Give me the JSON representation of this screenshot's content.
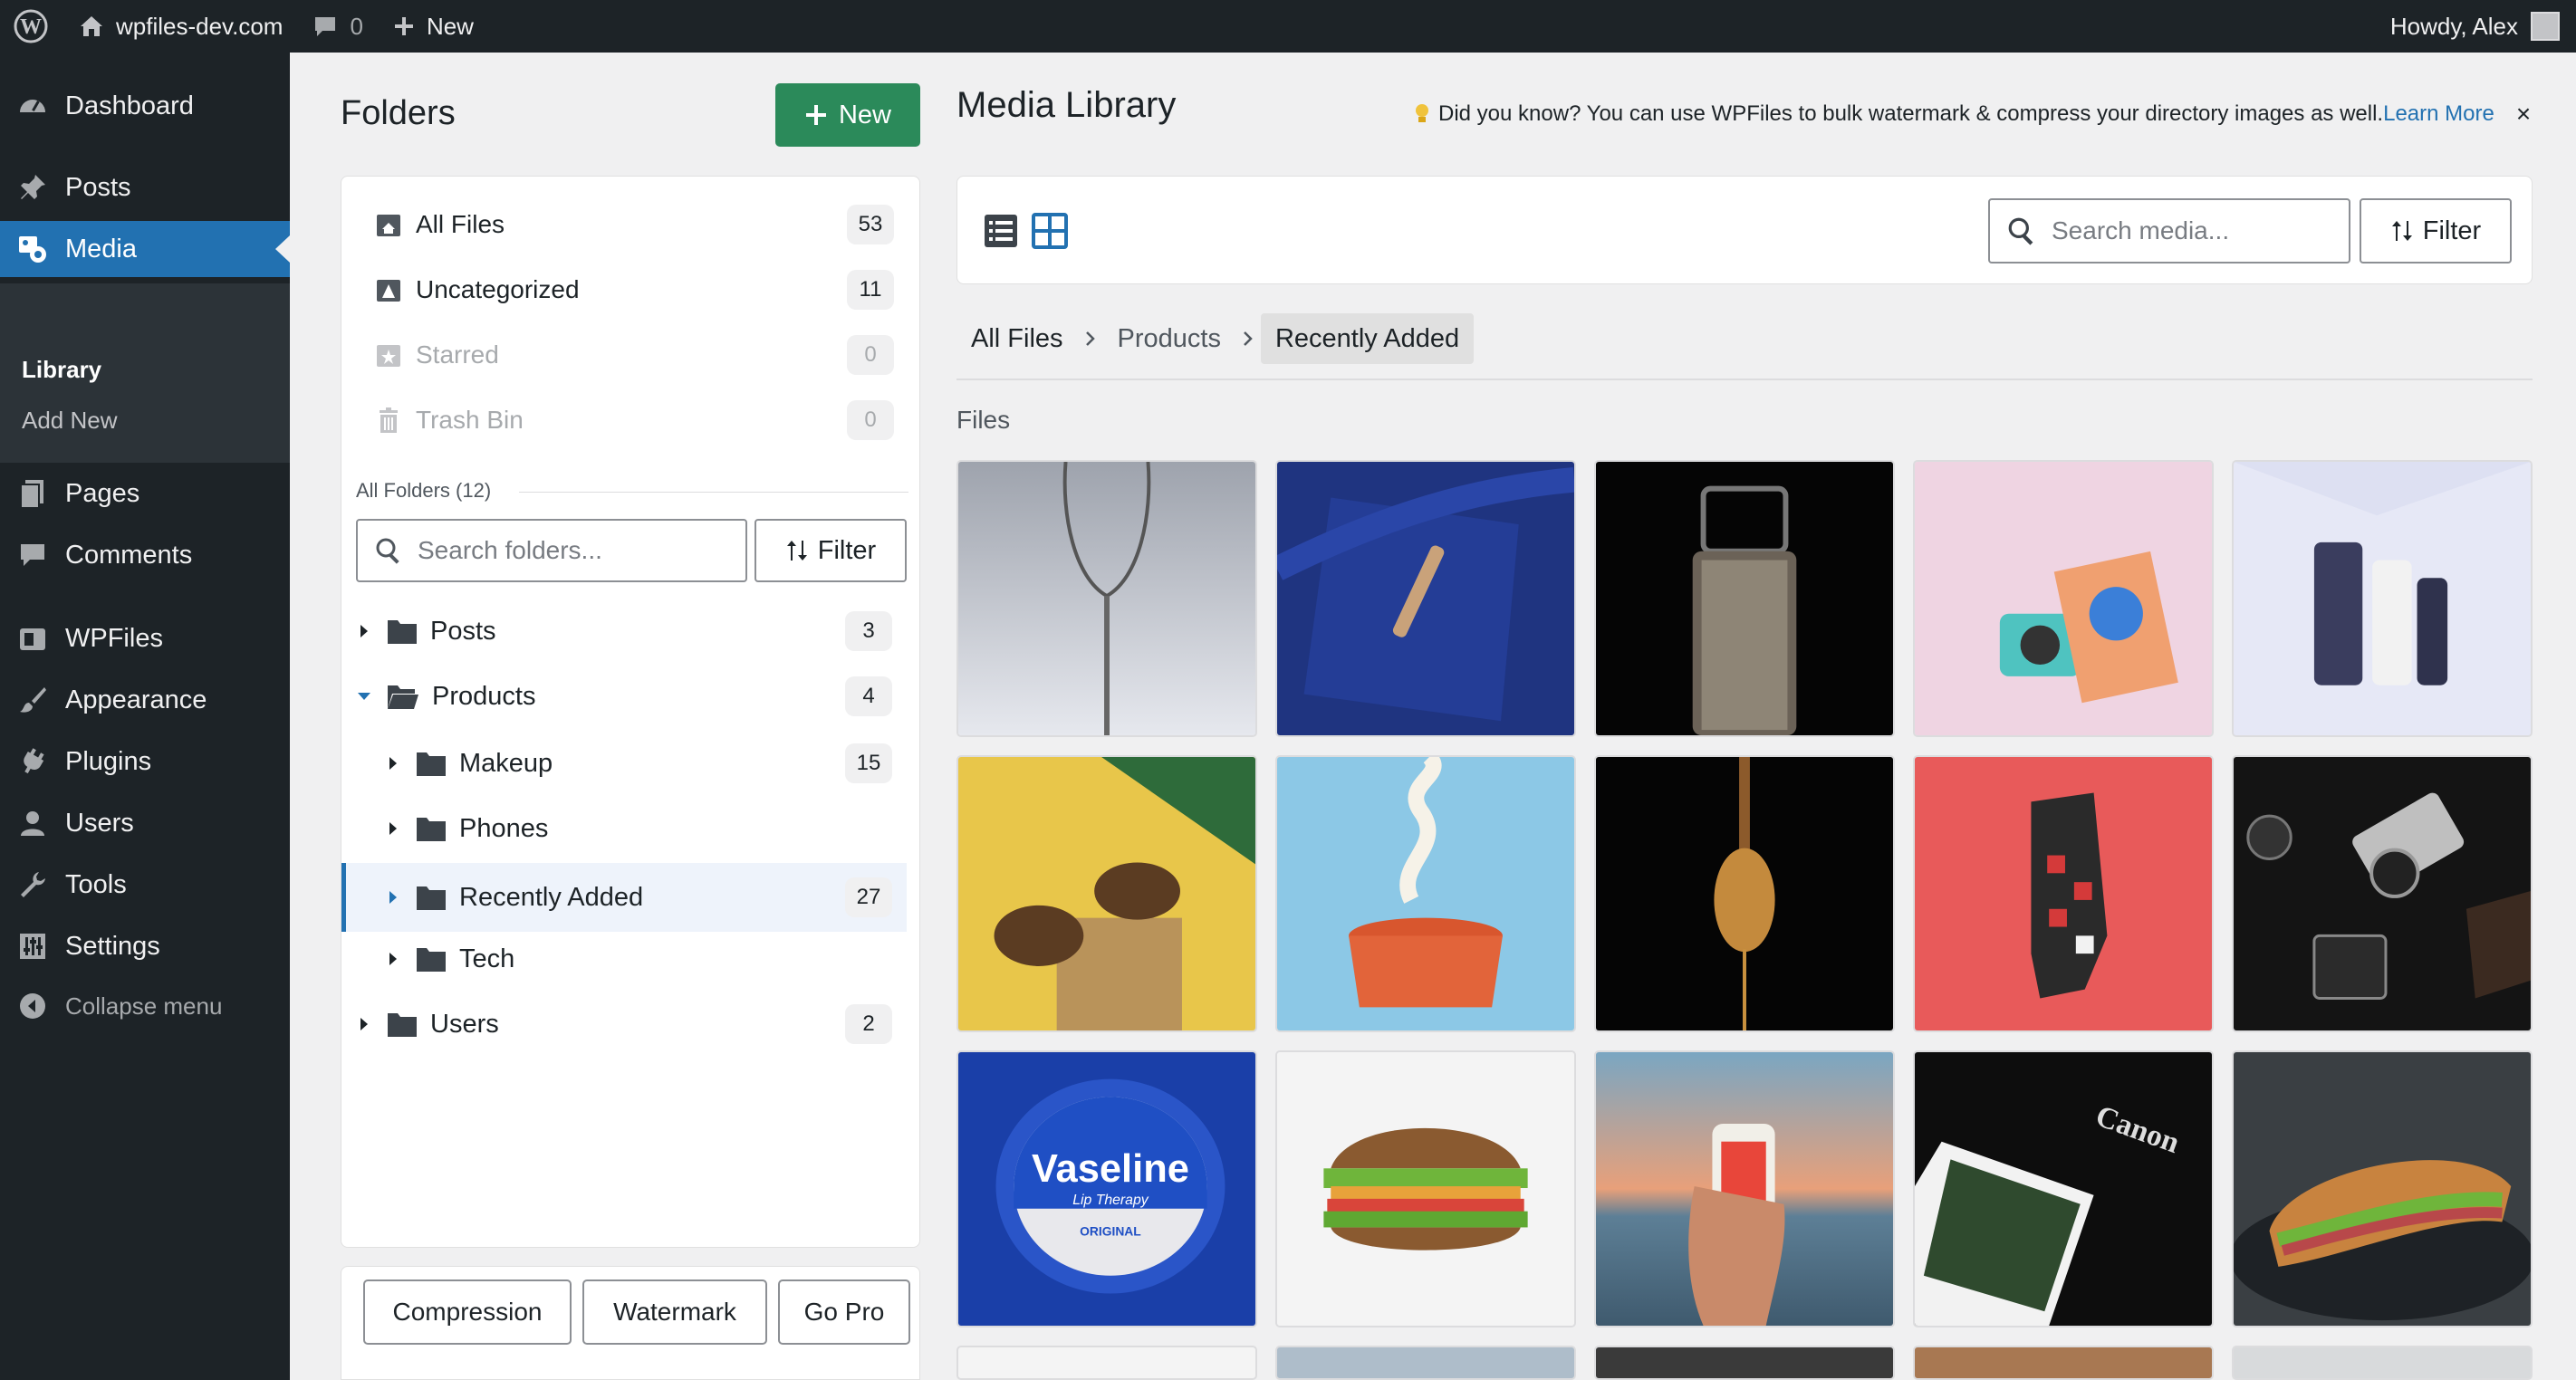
{
  "adminbar": {
    "site_name": "wpfiles-dev.com",
    "comments_count": "0",
    "new_label": "New",
    "howdy": "Howdy, Alex"
  },
  "sidebar": {
    "dashboard": "Dashboard",
    "posts": "Posts",
    "media": "Media",
    "library": "Library",
    "add_new": "Add New",
    "pages": "Pages",
    "comments": "Comments",
    "wpfiles": "WPFiles",
    "appearance": "Appearance",
    "plugins": "Plugins",
    "users": "Users",
    "tools": "Tools",
    "settings": "Settings",
    "collapse": "Collapse menu"
  },
  "folders": {
    "title": "Folders",
    "new_button": "New",
    "quick": [
      {
        "label": "All Files",
        "count": "53"
      },
      {
        "label": "Uncategorized",
        "count": "11"
      },
      {
        "label": "Starred",
        "count": "0"
      },
      {
        "label": "Trash Bin",
        "count": "0"
      }
    ],
    "all_folders_label": "All Folders (12)",
    "search_placeholder": "Search folders...",
    "filter_label": "Filter",
    "tree": [
      {
        "label": "Posts",
        "count": "3"
      },
      {
        "label": "Products",
        "count": "4"
      },
      {
        "label": "Makeup",
        "count": "15"
      },
      {
        "label": "Phones",
        "count": ""
      },
      {
        "label": "Recently Added",
        "count": "27"
      },
      {
        "label": "Tech",
        "count": ""
      },
      {
        "label": "Users",
        "count": "2"
      }
    ],
    "buttons": {
      "compression": "Compression",
      "watermark": "Watermark",
      "go_pro": "Go Pro"
    }
  },
  "main": {
    "title": "Media Library",
    "notice_text": "Did you know?  You can use WPFiles to bulk watermark & compress your directory images as well.",
    "notice_link": "Learn More",
    "notice_close": "×",
    "search_placeholder": "Search media...",
    "filter_label": "Filter",
    "breadcrumb": [
      "All Files",
      "Products",
      "Recently Added"
    ],
    "files_label": "Files",
    "tiles": [
      "wine glass",
      "blue gift with pen",
      "perfume bottle",
      "instant camera and notebook",
      "skincare tubes",
      "sunglasses on stand",
      "pot with noodles",
      "honey dipper",
      "sock on red",
      "vintage cameras",
      "vaseline tin",
      "sandwich",
      "hand holding can",
      "canon print",
      "sub sandwich"
    ],
    "tile_texts": {
      "vaseline": "Vaseline",
      "vaseline_sub": "Lip Therapy",
      "vaseline_original": "ORIGINAL",
      "canon": "Canon"
    }
  },
  "colors": {
    "admin_dark": "#1d2327",
    "accent_blue": "#2271b1",
    "new_green": "#2b8a5a"
  }
}
